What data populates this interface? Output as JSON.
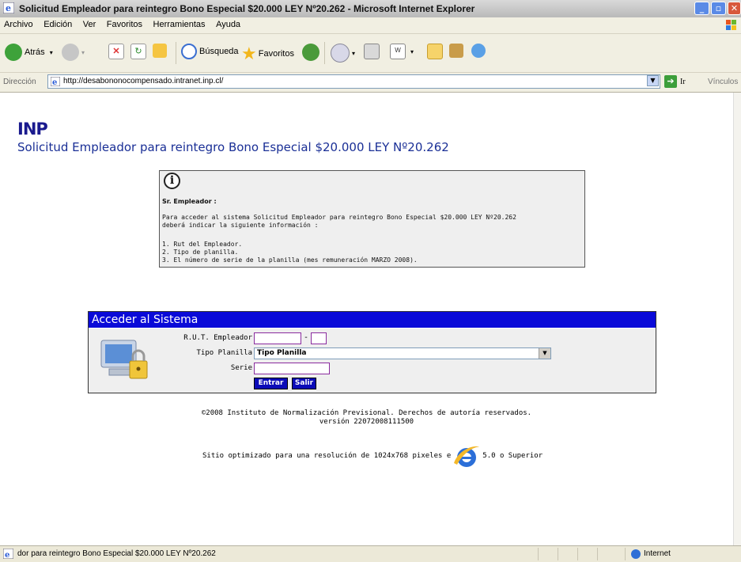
{
  "window": {
    "title": "Solicitud Empleador para reintegro Bono Especial $20.000 LEY Nº20.262 - Microsoft Internet Explorer"
  },
  "menu": [
    "Archivo",
    "Edición",
    "Ver",
    "Favoritos",
    "Herramientas",
    "Ayuda"
  ],
  "toolbar": {
    "back": "Atrás",
    "search": "Búsqueda",
    "favorites": "Favoritos"
  },
  "addressbar": {
    "label": "Dirección",
    "url": "http://desabononocompensado.intranet.inp.cl/",
    "go": "Ir",
    "links": "Vínculos"
  },
  "page": {
    "logo": "INP",
    "title": "Solicitud Empleador para reintegro Bono Especial $20.000 LEY Nº20.262",
    "info": {
      "greeting": "Sr. Empleador :",
      "paragraph": "Para acceder al sistema Solicitud Empleador para reintegro Bono Especial $20.000 LEY Nº20.262\ndeberá indicar la siguiente información :",
      "list": "1. Rut del Empleador.\n2. Tipo de planilla.\n3. El número de serie de la planilla (mes remuneración MARZO 2008)."
    },
    "login": {
      "header": "Acceder al Sistema",
      "rut_label": "R.U.T. Empleador",
      "rut_value": "",
      "dash": "-",
      "dv_value": "",
      "tipo_label": "Tipo Planilla",
      "tipo_selected": "Tipo Planilla",
      "serie_label": "Serie",
      "serie_value": "",
      "enter_button": "Entrar",
      "exit_button": "Salir"
    },
    "footer": {
      "copyright": "©2008 Instituto de Normalización Previsional. Derechos de autoría reservados.",
      "version": "versión 22072008111500",
      "optimized_pre": "Sitio optimizado para una resolución de 1024x768 pixeles e",
      "optimized_post": "5.0 o Superior"
    }
  },
  "statusbar": {
    "text": "dor para reintegro Bono Especial $20.000 LEY Nº20.262",
    "zone": "Internet"
  }
}
